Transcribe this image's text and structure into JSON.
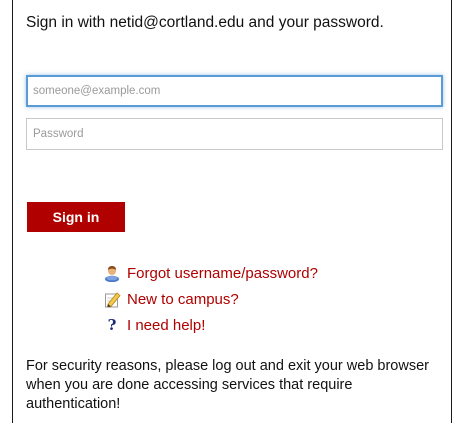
{
  "heading": "Sign in with netid@cortland.edu and your password.",
  "form": {
    "email_placeholder": "someone@example.com",
    "email_value": "",
    "password_placeholder": "Password",
    "password_value": "",
    "signin_label": "Sign in"
  },
  "links": [
    {
      "label": "Forgot username/password?",
      "icon": "user-icon"
    },
    {
      "label": "New to campus?",
      "icon": "pencil-icon"
    },
    {
      "label": "I need help!",
      "icon": "question-icon"
    }
  ],
  "notice": "For security reasons, please log out and exit your web browser when you are done accessing services that require authentication!",
  "colors": {
    "accent": "#b00000",
    "focus_border": "#5b9bd5",
    "help_icon": "#1a2a7a"
  }
}
